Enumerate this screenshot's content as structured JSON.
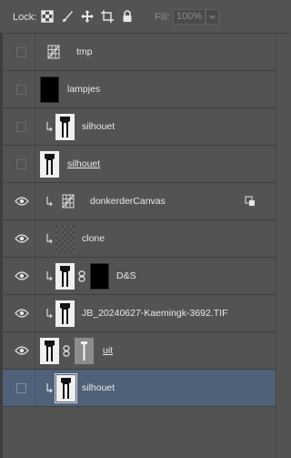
{
  "toolbar": {
    "lock_label": "Lock:",
    "fill_label": "Fill:",
    "fill_value": "100%"
  },
  "layers": [
    {
      "name": "tmp",
      "visible": false,
      "thumb": "grid-adjustment-icon",
      "clip": false,
      "underline": false,
      "selected": false
    },
    {
      "name": "lampjes",
      "visible": false,
      "thumb": "black-layer",
      "clip": false,
      "underline": false,
      "selected": false
    },
    {
      "name": "silhouet",
      "visible": false,
      "thumb": "silhouette",
      "clip": true,
      "underline": false,
      "selected": false
    },
    {
      "name": "silhouet ",
      "visible": false,
      "thumb": "silhouette",
      "clip": false,
      "underline": true,
      "selected": false
    },
    {
      "name": "donkerderCanvas",
      "visible": true,
      "thumb": "grid-adjustment-icon",
      "clip": true,
      "underline": false,
      "selected": false,
      "fx": true
    },
    {
      "name": "clone",
      "visible": true,
      "thumb": "transparent-checker",
      "clip": true,
      "underline": false,
      "selected": false
    },
    {
      "name": "D&S",
      "visible": true,
      "thumb": "silhouette",
      "mask": "black-mask",
      "clip": true,
      "underline": false,
      "selected": false
    },
    {
      "name": "JB_20240627-Kaemingk-3692.TIF",
      "visible": true,
      "thumb": "silhouette",
      "clip": true,
      "underline": false,
      "selected": false
    },
    {
      "name": "uit",
      "visible": true,
      "thumb": "silhouette",
      "mask": "gray-mask",
      "clip": false,
      "underline": true,
      "selected": false
    },
    {
      "name": "silhouet",
      "visible": false,
      "thumb": "silhouette",
      "clip": true,
      "underline": false,
      "selected": true
    }
  ]
}
